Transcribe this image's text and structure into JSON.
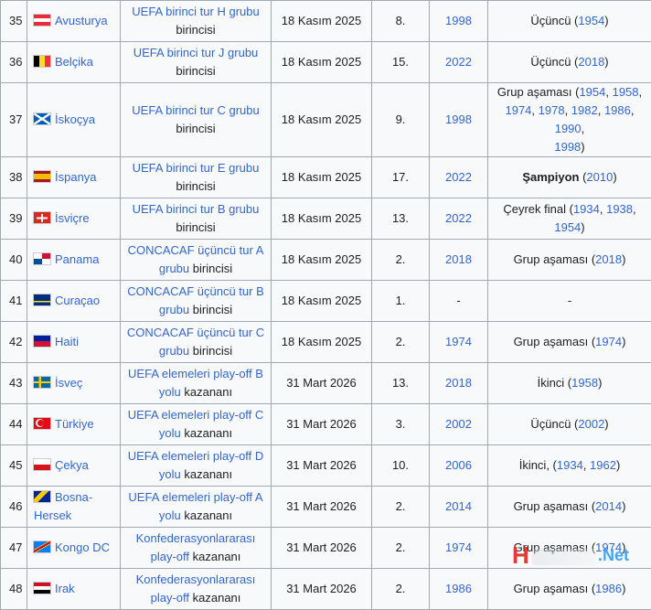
{
  "table": {
    "rows": [
      {
        "num": "35",
        "flag": "austria",
        "team": "Avusturya",
        "qual_link": "UEFA birinci tur H grubu",
        "qual_text": "birincisi",
        "date": "18 Kasım 2025",
        "appear": "8.",
        "last": "1998",
        "best": [
          {
            "t": "Üçüncü ("
          },
          {
            "l": "1954"
          },
          {
            "t": ")"
          }
        ]
      },
      {
        "num": "36",
        "flag": "belgium",
        "team": "Belçika",
        "qual_link": "UEFA birinci tur J grubu",
        "qual_text": "birincisi",
        "date": "18 Kasım 2025",
        "appear": "15.",
        "last": "2022",
        "best": [
          {
            "t": "Üçüncü ("
          },
          {
            "l": "2018"
          },
          {
            "t": ")"
          }
        ]
      },
      {
        "num": "37",
        "flag": "scotland",
        "team": "İskoçya",
        "qual_link": "UEFA birinci tur C grubu",
        "qual_text": "birincisi",
        "date": "18 Kasım 2025",
        "appear": "9.",
        "last": "1998",
        "best": [
          {
            "t": "Grup aşaması ("
          },
          {
            "l": "1954"
          },
          {
            "t": ", "
          },
          {
            "l": "1958"
          },
          {
            "t": ",\n"
          },
          {
            "l": "1974"
          },
          {
            "t": ", "
          },
          {
            "l": "1978"
          },
          {
            "t": ", "
          },
          {
            "l": "1982"
          },
          {
            "t": ", "
          },
          {
            "l": "1986"
          },
          {
            "t": ", "
          },
          {
            "l": "1990"
          },
          {
            "t": ",\n"
          },
          {
            "l": "1998"
          },
          {
            "t": ")"
          }
        ]
      },
      {
        "num": "38",
        "flag": "spain",
        "team": "İspanya",
        "qual_link": "UEFA birinci tur E grubu",
        "qual_text": "birincisi",
        "date": "18 Kasım 2025",
        "appear": "17.",
        "last": "2022",
        "best": [
          {
            "b": "Şampiyon"
          },
          {
            "t": " ("
          },
          {
            "l": "2010"
          },
          {
            "t": ")"
          }
        ]
      },
      {
        "num": "39",
        "flag": "switzerland",
        "team": "İsviçre",
        "qual_link": "UEFA birinci tur B grubu",
        "qual_text": "birincisi",
        "date": "18 Kasım 2025",
        "appear": "13.",
        "last": "2022",
        "best": [
          {
            "t": "Çeyrek final ("
          },
          {
            "l": "1934"
          },
          {
            "t": ", "
          },
          {
            "l": "1938"
          },
          {
            "t": ", "
          },
          {
            "l": "1954"
          },
          {
            "t": ")"
          }
        ]
      },
      {
        "num": "40",
        "flag": "panama",
        "team": "Panama",
        "qual_link": "CONCACAF üçüncü tur A grubu",
        "qual_text": "birincisi",
        "date": "18 Kasım 2025",
        "appear": "2.",
        "last": "2018",
        "best": [
          {
            "t": "Grup aşaması ("
          },
          {
            "l": "2018"
          },
          {
            "t": ")"
          }
        ]
      },
      {
        "num": "41",
        "flag": "curacao",
        "team": "Curaçao",
        "qual_link": "CONCACAF üçüncü tur B grubu",
        "qual_text": "birincisi",
        "date": "18 Kasım 2025",
        "appear": "1.",
        "last": "-",
        "best": [
          {
            "t": "-"
          }
        ]
      },
      {
        "num": "42",
        "flag": "haiti",
        "team": "Haiti",
        "qual_link": "CONCACAF üçüncü tur C grubu",
        "qual_text": "birincisi",
        "date": "18 Kasım 2025",
        "appear": "2.",
        "last": "1974",
        "best": [
          {
            "t": "Grup aşaması ("
          },
          {
            "l": "1974"
          },
          {
            "t": ")"
          }
        ]
      },
      {
        "num": "43",
        "flag": "sweden",
        "team": "İsveç",
        "qual_link": "UEFA elemeleri play-off B yolu",
        "qual_text": "kazananı",
        "date": "31 Mart 2026",
        "appear": "13.",
        "last": "2018",
        "best": [
          {
            "t": "İkinci ("
          },
          {
            "l": "1958"
          },
          {
            "t": ")"
          }
        ]
      },
      {
        "num": "44",
        "flag": "turkey",
        "team": "Türkiye",
        "qual_link": "UEFA elemeleri play-off C yolu",
        "qual_text": "kazananı",
        "date": "31 Mart 2026",
        "appear": "3.",
        "last": "2002",
        "best": [
          {
            "t": "Üçüncü ("
          },
          {
            "l": "2002"
          },
          {
            "t": ")"
          }
        ]
      },
      {
        "num": "45",
        "flag": "czechia",
        "team": "Çekya",
        "qual_link": "UEFA elemeleri play-off D yolu",
        "qual_text": "kazananı",
        "date": "31 Mart 2026",
        "appear": "10.",
        "last": "2006",
        "best": [
          {
            "t": "İkinci, ("
          },
          {
            "l": "1934"
          },
          {
            "t": ", "
          },
          {
            "l": "1962"
          },
          {
            "t": ")"
          }
        ]
      },
      {
        "num": "46",
        "flag": "bosnia",
        "team": "Bosna-Hersek",
        "qual_link": "UEFA elemeleri play-off A yolu",
        "qual_text": "kazananı",
        "date": "31 Mart 2026",
        "appear": "2.",
        "last": "2014",
        "best": [
          {
            "t": "Grup aşaması ("
          },
          {
            "l": "2014"
          },
          {
            "t": ")"
          }
        ]
      },
      {
        "num": "47",
        "flag": "drcongo",
        "team": "Kongo DC",
        "qual_link": "Konfederasyonlararası play-off",
        "qual_text": "kazananı",
        "date": "31 Mart 2026",
        "appear": "2.",
        "last": "1974",
        "best": [
          {
            "t": "Grup aşaması ("
          },
          {
            "l": "1974"
          },
          {
            "t": ")"
          }
        ]
      },
      {
        "num": "48",
        "flag": "iraq",
        "team": "Irak",
        "qual_link": "Konfederasyonlararası play-off",
        "qual_text": "kazananı",
        "date": "31 Mart 2026",
        "appear": "2.",
        "last": "1986",
        "best": [
          {
            "t": "Grup aşaması ("
          },
          {
            "l": "1986"
          },
          {
            "t": ")"
          }
        ]
      }
    ]
  },
  "watermark": {
    "left": "H",
    "right": ".Net"
  }
}
